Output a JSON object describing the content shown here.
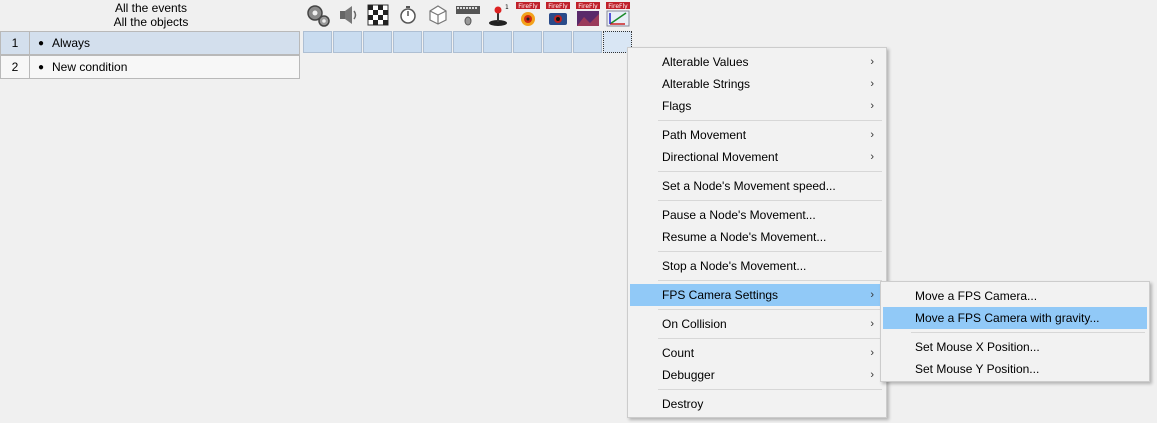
{
  "events_header": {
    "line1": "All the events",
    "line2": "All the objects"
  },
  "events": [
    {
      "number": "1",
      "label": "Always"
    },
    {
      "number": "2",
      "label": "New condition"
    }
  ],
  "object_icons": [
    {
      "name": "special-gears-icon"
    },
    {
      "name": "sound-speaker-icon"
    },
    {
      "name": "storyboard-checker-icon"
    },
    {
      "name": "timer-stopwatch-icon"
    },
    {
      "name": "create-object-cube-icon"
    },
    {
      "name": "keyboard-mouse-icon"
    },
    {
      "name": "player-joystick-icon"
    },
    {
      "name": "firefly-particle-icon",
      "badge": "FireFly"
    },
    {
      "name": "firefly-camera-icon",
      "badge": "FireFly"
    },
    {
      "name": "firefly-scene-icon",
      "badge": "FireFly"
    },
    {
      "name": "firefly-node-icon",
      "badge": "FireFly"
    }
  ],
  "context_menu": {
    "items": [
      {
        "label": "Alterable Values",
        "submenu": true
      },
      {
        "label": "Alterable Strings",
        "submenu": true
      },
      {
        "label": "Flags",
        "submenu": true
      },
      {
        "label": "Path Movement",
        "submenu": true
      },
      {
        "label": "Directional Movement",
        "submenu": true
      },
      {
        "label": "Set a Node's Movement speed...",
        "submenu": false
      },
      {
        "label": "Pause a Node's Movement...",
        "submenu": false
      },
      {
        "label": "Resume a Node's Movement...",
        "submenu": false
      },
      {
        "label": "Stop a Node's Movement...",
        "submenu": false
      },
      {
        "label": "FPS Camera Settings",
        "submenu": true
      },
      {
        "label": "On Collision",
        "submenu": true
      },
      {
        "label": "Count",
        "submenu": true
      },
      {
        "label": "Debugger",
        "submenu": true
      },
      {
        "label": "Destroy",
        "submenu": false
      }
    ]
  },
  "submenu": {
    "items": [
      {
        "label": "Move a FPS Camera..."
      },
      {
        "label": "Move a FPS Camera with gravity..."
      },
      {
        "label": "Set Mouse X Position..."
      },
      {
        "label": "Set Mouse Y Position..."
      }
    ]
  },
  "submenu_arrow": "›",
  "colors": {
    "highlight": "#91c9f7",
    "selected_row": "#d3dfed",
    "grid_cell": "#c9dcf0"
  }
}
